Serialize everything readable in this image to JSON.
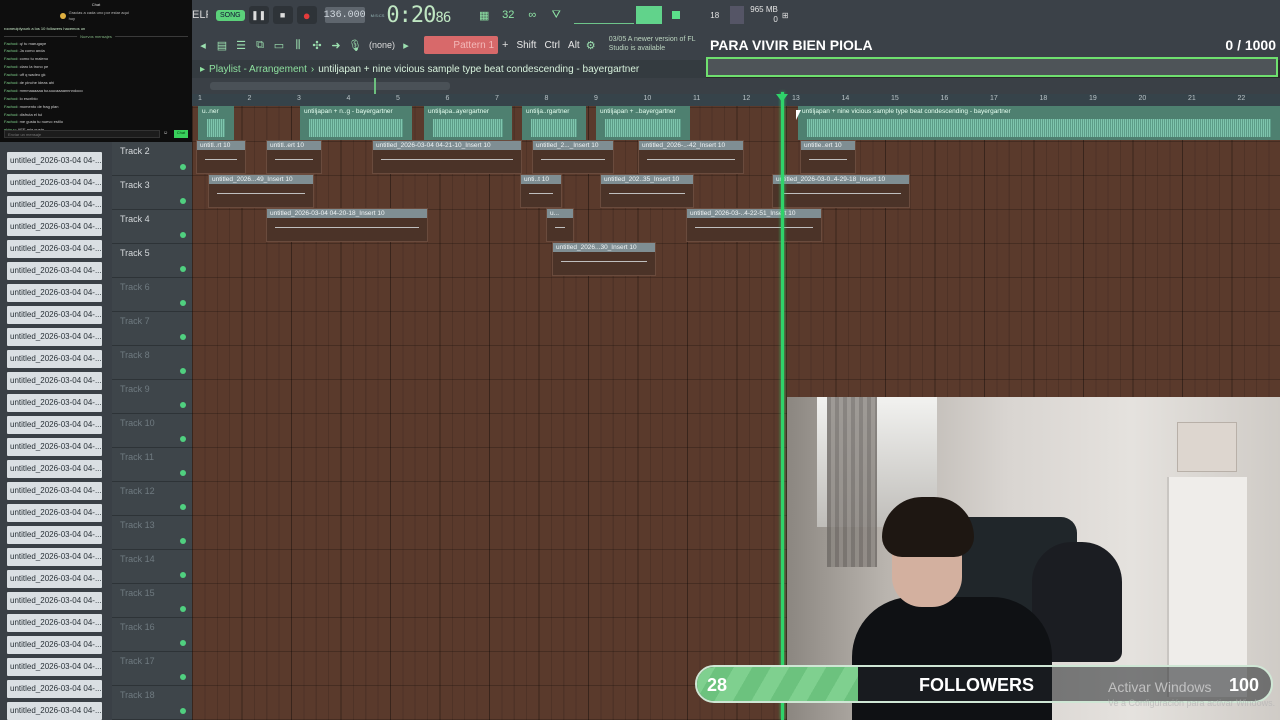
{
  "chat": {
    "header": "Chat",
    "pinned": "Gracias a cada uno por estar aqui hoy",
    "first_line": "rooneuiplyourk a los 10 followers hacemos un",
    "divider": "Nuevos mensajes",
    "messages": [
      {
        "user": "Fachod",
        "text": "q/ tu marugaye"
      },
      {
        "user": "Fachod",
        "text": "Ja como anda"
      },
      {
        "user": "Fachod",
        "text": "como tu maleno"
      },
      {
        "user": "Fachod",
        "text": "claro la trono pe"
      },
      {
        "user": "Fachod",
        "text": "uff q wadeo gk"
      },
      {
        "user": "Fachod",
        "text": "de pinche ideas ahi"
      },
      {
        "user": "Fachod",
        "text": "mmmaaaaaa tuuuucaaaannnndooo"
      },
      {
        "user": "Fachod",
        "text": "lo escribio"
      },
      {
        "user": "Fachod",
        "text": "momento de frag plan"
      },
      {
        "user": "Fachod",
        "text": "disfruta el tui"
      },
      {
        "user": "Fachod",
        "text": "me gusta tu nuevo estilo"
      },
      {
        "user": "ebjsuy",
        "text": "AEE mia gusta"
      }
    ],
    "input_placeholder": "Enviar un mensaje",
    "send_label": "Chat"
  },
  "toolbar": {
    "help": "ELP",
    "song_mode": "SONG",
    "tempo": "136.000",
    "time_label": "M:S:CS",
    "time": "0:20",
    "time_cs": "86",
    "cpu": "18",
    "ram": "965 MB",
    "ram2": "0",
    "snap_none": "(none)",
    "pattern": "Pattern 1",
    "shift": "Shift",
    "ctrl": "Ctrl",
    "alt": "Alt",
    "news_date": "03/05",
    "news_text": "A newer version of FL Studio is available"
  },
  "goal": {
    "title": "PARA VIVIR BIEN PIOLA",
    "count": "0 / 1000"
  },
  "playlist": {
    "title_prefix": "Playlist - Arrangement",
    "song": "untiljapan + nine vicious sample type beat condescending - bayergartner"
  },
  "ruler": [
    "1",
    "2",
    "3",
    "4",
    "5",
    "6",
    "7",
    "8",
    "9",
    "10",
    "11",
    "12",
    "13",
    "14",
    "15",
    "16",
    "17",
    "18",
    "19",
    "20",
    "21",
    "22"
  ],
  "tracks": [
    {
      "name": "Track 2",
      "dim": false
    },
    {
      "name": "Track 3",
      "dim": false
    },
    {
      "name": "Track 4",
      "dim": false
    },
    {
      "name": "Track 5",
      "dim": false
    },
    {
      "name": "Track 6",
      "dim": true
    },
    {
      "name": "Track 7",
      "dim": true
    },
    {
      "name": "Track 8",
      "dim": true
    },
    {
      "name": "Track 9",
      "dim": true
    },
    {
      "name": "Track 10",
      "dim": true
    },
    {
      "name": "Track 11",
      "dim": true
    },
    {
      "name": "Track 12",
      "dim": true
    },
    {
      "name": "Track 13",
      "dim": true
    },
    {
      "name": "Track 14",
      "dim": true
    },
    {
      "name": "Track 15",
      "dim": true
    },
    {
      "name": "Track 16",
      "dim": true
    },
    {
      "name": "Track 17",
      "dim": true
    },
    {
      "name": "Track 18",
      "dim": true
    }
  ],
  "picker_label": "untitled_2026-03-04 04-...",
  "picker_count": 27,
  "clips": [
    {
      "label": "u..ner",
      "type": "audio"
    },
    {
      "label": "untiljapan + n..g - bayergartner",
      "type": "audio"
    },
    {
      "label": "untiljapa..ayergartner",
      "type": "audio"
    },
    {
      "label": "untilja..rgartner",
      "type": "audio"
    },
    {
      "label": "untiljapan + ..bayergartner",
      "type": "audio"
    },
    {
      "label": "untiljapan + nine vicious sample type beat condescending - bayergartner",
      "type": "audio"
    },
    {
      "label": "untitl..rt 10",
      "type": "insert"
    },
    {
      "label": "untitl..ert 10",
      "type": "insert"
    },
    {
      "label": "untitled_2026-03-04 04-21-10_Insert 10",
      "type": "insert"
    },
    {
      "label": "untitled_2..._Insert 10",
      "type": "insert"
    },
    {
      "label": "untitled_2026-..-42_Insert 10",
      "type": "insert"
    },
    {
      "label": "untitle..ert 10",
      "type": "insert"
    },
    {
      "label": "untitled_2026...49_Insert 10",
      "type": "insert"
    },
    {
      "label": "unti..t 10",
      "type": "insert"
    },
    {
      "label": "untitled_202..35_Insert 10",
      "type": "insert"
    },
    {
      "label": "untitled_2026-03-0..4-29-18_Insert 10",
      "type": "insert"
    },
    {
      "label": "untitled_2026-03-04 04-20-18_Insert 10",
      "type": "insert"
    },
    {
      "label": "u...",
      "type": "insert"
    },
    {
      "label": "untitled_2026-03-..4-22-51_Insert 10",
      "type": "insert"
    },
    {
      "label": "untitled_2026...30_Insert 10",
      "type": "insert"
    }
  ],
  "followers": {
    "current": "28",
    "label": "FOLLOWERS",
    "goal": "100",
    "progress": 0.28
  },
  "windows_notice": {
    "title": "Activar Windows",
    "subtitle": "Ve a Configuración para activar Windows."
  }
}
